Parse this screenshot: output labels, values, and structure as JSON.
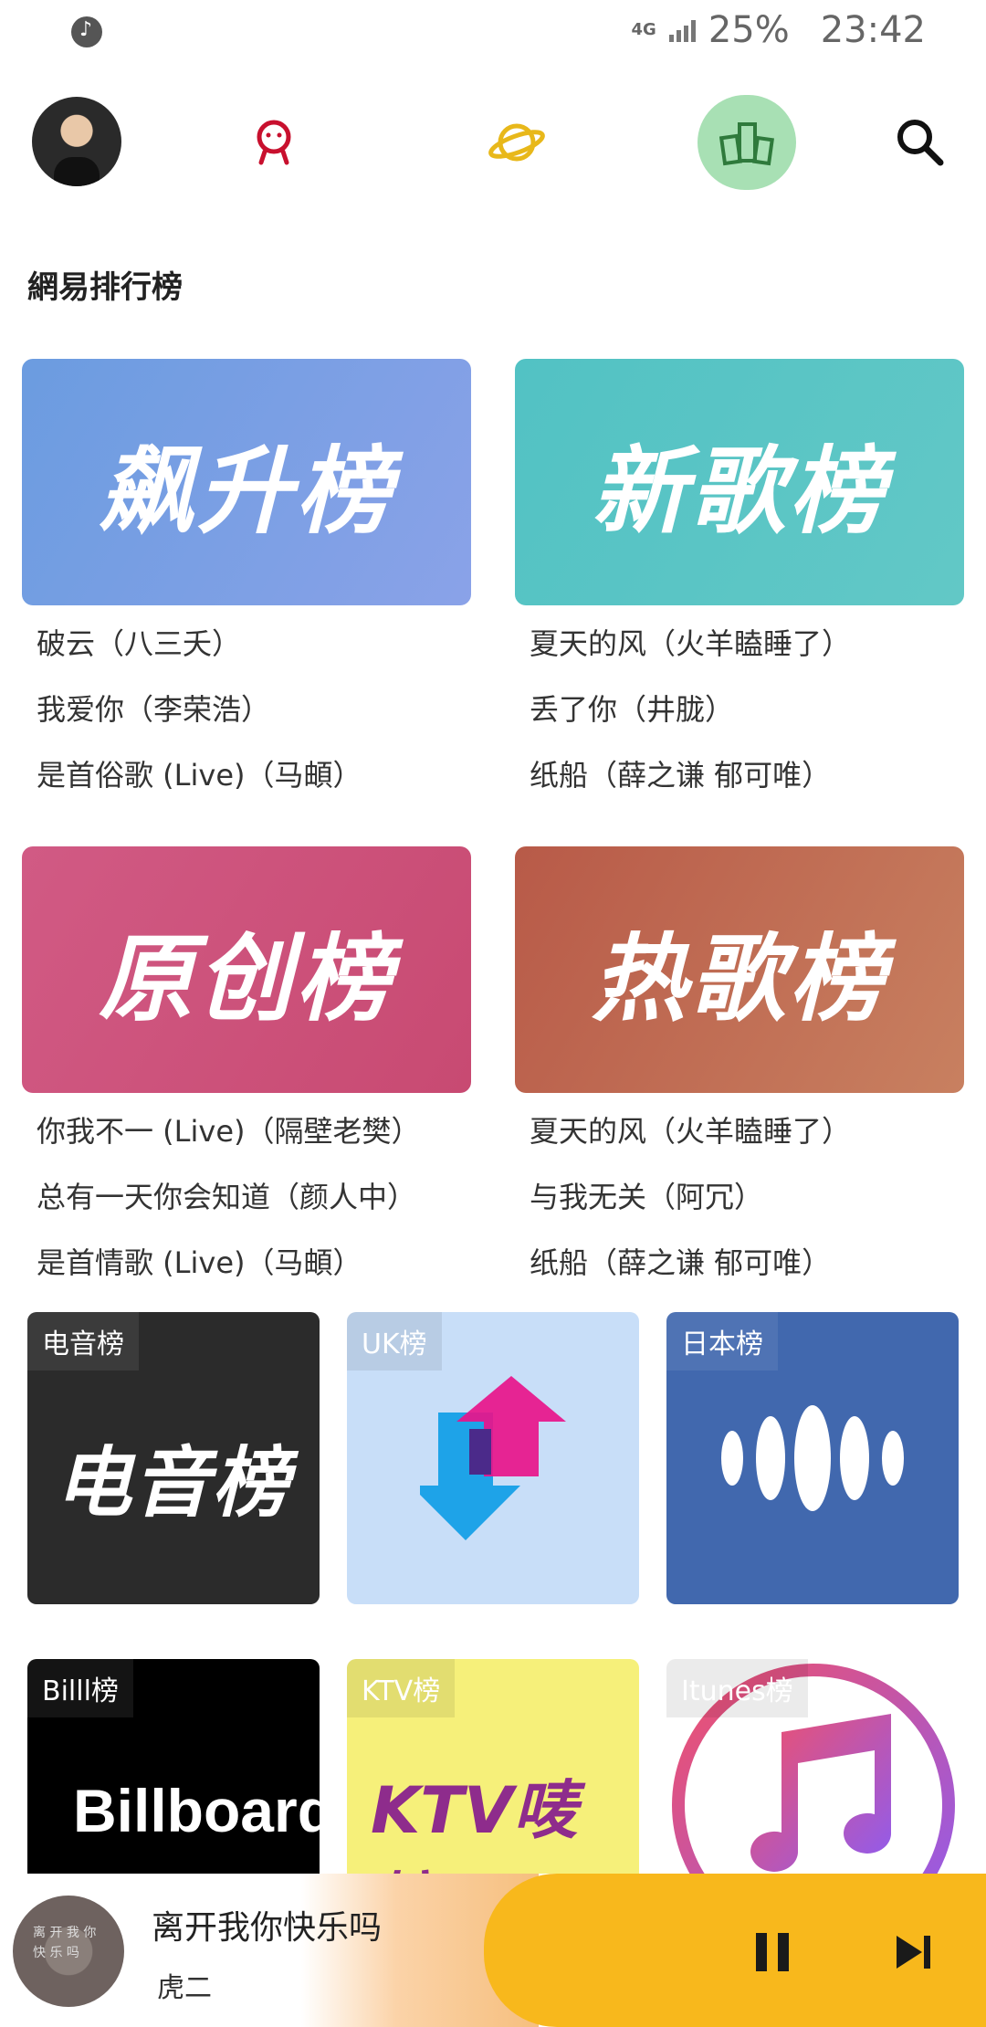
{
  "status_bar": {
    "network": "4G",
    "battery": "25%",
    "time": "23:42"
  },
  "nav": {
    "avatar": "avatar",
    "icons": [
      "mine-icon",
      "explore-icon",
      "charts-icon",
      "search-icon"
    ],
    "active": "charts",
    "active_color": "#a8e0b4"
  },
  "section": {
    "title": "網易排行榜"
  },
  "big_charts": [
    {
      "cover_text": "飙升榜",
      "tracks": [
        "破云（八三夭）",
        "我爱你（李荣浩）",
        "是首俗歌 (Live)（马頔）"
      ]
    },
    {
      "cover_text": "新歌榜",
      "tracks": [
        "夏天的风（火羊瞌睡了）",
        "丢了你（井胧）",
        "纸船（薛之谦 郁可唯）"
      ]
    },
    {
      "cover_text": "原创榜",
      "tracks": [
        "你我不一 (Live)（隔壁老樊）",
        "总有一天你会知道（颜人中）",
        "是首情歌 (Live)（马頔）"
      ]
    },
    {
      "cover_text": "热歌榜",
      "tracks": [
        "夏天的风（火羊瞌睡了）",
        "与我无关（阿冗）",
        "纸船（薛之谦 郁可唯）"
      ]
    }
  ],
  "small_charts": [
    {
      "label": "电音榜",
      "art": "电音榜"
    },
    {
      "label": "UK榜"
    },
    {
      "label": "日本榜"
    },
    {
      "label": "Billl榜",
      "art": "Billboard"
    },
    {
      "label": "KTV榜",
      "art": "KTV唛榜"
    },
    {
      "label": "Itunes榜"
    }
  ],
  "player": {
    "disc_text": "离 开 我 你 快 乐 吗",
    "title": "离开我你快乐吗",
    "artist": "虎二",
    "accent": "#f8b81c"
  }
}
